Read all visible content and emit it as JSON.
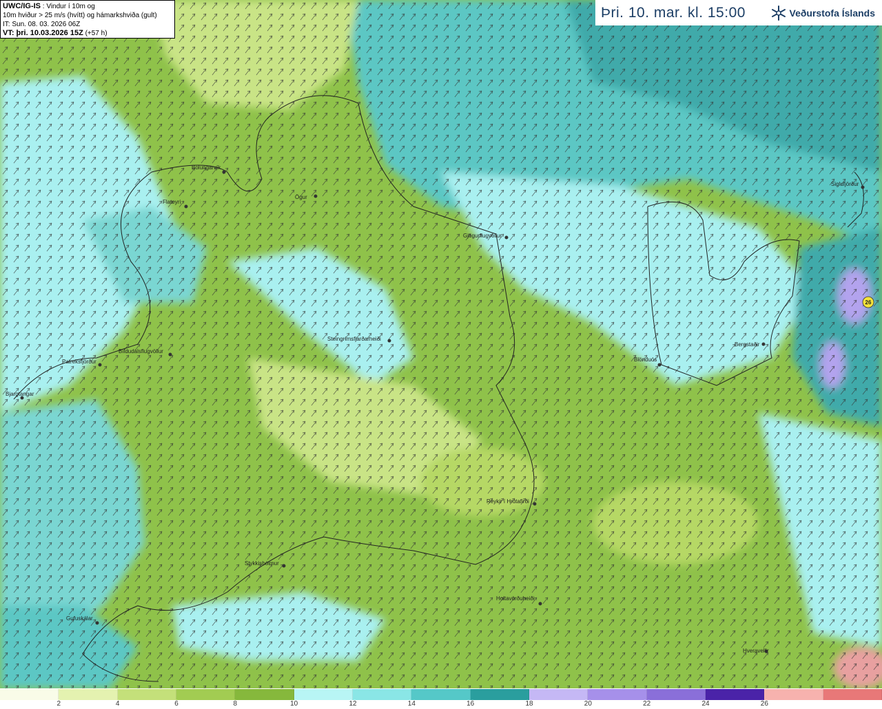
{
  "info": {
    "line1_bold": "UWC/IG-IS",
    "line1_rest": " : Vindur í 10m og",
    "line2": "10m hviður > 25 m/s (hvítt) og hámarkshviða (gult)",
    "line3": "IT: Sun. 08. 03. 2026 06Z",
    "line4_bold": "VT: þri. 10.03.2026 15Z",
    "line4_rest": " (+57 h)"
  },
  "header": {
    "valid_title": "Þri. 10. mar. kl. 15:00",
    "brand": "Veðurstofa Íslands",
    "brand_icon": "snowflake-logo-icon"
  },
  "places": [
    {
      "name": "Bolungarvík"
    },
    {
      "name": "Flateyri"
    },
    {
      "name": "Ögur"
    },
    {
      "name": "Gjögurflugvöllur"
    },
    {
      "name": "Siglufjörður"
    },
    {
      "name": "Steingrímsfjarðarheiði"
    },
    {
      "name": "Bíldudalsflugvöllur"
    },
    {
      "name": "Patreksfjörður"
    },
    {
      "name": "Bjargtangar"
    },
    {
      "name": "Blönduós"
    },
    {
      "name": "Bergstaðir"
    },
    {
      "name": "Reykir í Hrútafirði"
    },
    {
      "name": "Stykkishólmur"
    },
    {
      "name": "Holtavörðuheiði"
    },
    {
      "name": "Gufuskálar"
    },
    {
      "name": "Hveravellir"
    }
  ],
  "max_gust_badge": "26",
  "legend": {
    "unit_note": "",
    "colors": [
      "#f9fce8",
      "#e4f2b0",
      "#c4e07a",
      "#a2cc52",
      "#86b83c",
      "#b8f5f5",
      "#8ae6e6",
      "#55c8c8",
      "#2a9e9e",
      "#c5b8f5",
      "#a690ea",
      "#8a6fd9",
      "#4a23a8",
      "#f7b2ae",
      "#e87878"
    ],
    "ticks": [
      "2",
      "4",
      "6",
      "8",
      "10",
      "12",
      "14",
      "16",
      "18",
      "20",
      "22",
      "24",
      "26"
    ]
  }
}
